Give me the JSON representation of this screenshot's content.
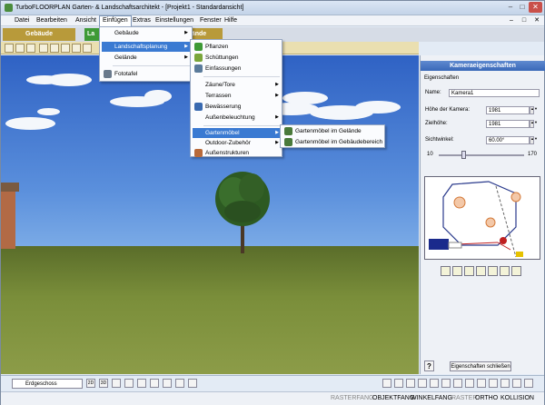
{
  "window": {
    "title": "TurboFLOORPLAN Garten- & Landschaftsarchitekt - [Projekt1 - Standardansicht]"
  },
  "menubar": [
    "Datei",
    "Bearbeiten",
    "Ansicht",
    "Einfügen",
    "Extras",
    "Einstellungen",
    "Fenster",
    "Hilfe"
  ],
  "tabs": {
    "gebaeude": "Gebäude",
    "landschaft": "La",
    "gelaende": "elände"
  },
  "menu_einfuegen": [
    "Gebäude",
    "Landschaftsplanung",
    "Gelände",
    "Fototafel"
  ],
  "menu_landschaft": [
    "Pflanzen",
    "Schüttungen",
    "Einfassungen",
    "Zäune/Tore",
    "Terrassen",
    "Bewässerung",
    "Außenbeleuchtung",
    "Gartenmöbel",
    "Outdoor-Zubehör",
    "Außenstrukturen"
  ],
  "menu_gartenmoebel": [
    "Gartenmöbel im Gelände",
    "Gartenmöbel im Gebäudebereich"
  ],
  "panel": {
    "title": "Kameraeigenschaften",
    "section": "Eigenschaften",
    "name_label": "Name:",
    "name_value": "Kamera1",
    "hoehe_label": "Höhe der Kamera:",
    "hoehe_value": "1981",
    "ziel_label": "Zielhöhe:",
    "ziel_value": "1981",
    "sicht_label": "Sichtwinkel:",
    "sicht_value": "60.00°",
    "slider_min": "10",
    "slider_max": "170",
    "help": "?",
    "close_button": "Eigenschaften schließen"
  },
  "bottom": {
    "floor": "Erdgeschoss",
    "view_2d": "2D",
    "view_3d": "3D"
  },
  "status": [
    "RASTERFANG",
    "OBJEKTFANG",
    "WINKELFANG",
    "RASTER",
    "ORTHO",
    "KOLLISION"
  ],
  "colors": {
    "tab_gebaeude": "#b89a3a",
    "tab_landschaft": "#3e9a36",
    "tab_gelaende": "#b89a3a",
    "highlight": "#3a7ad2",
    "panel_header": "#4a78c4"
  }
}
